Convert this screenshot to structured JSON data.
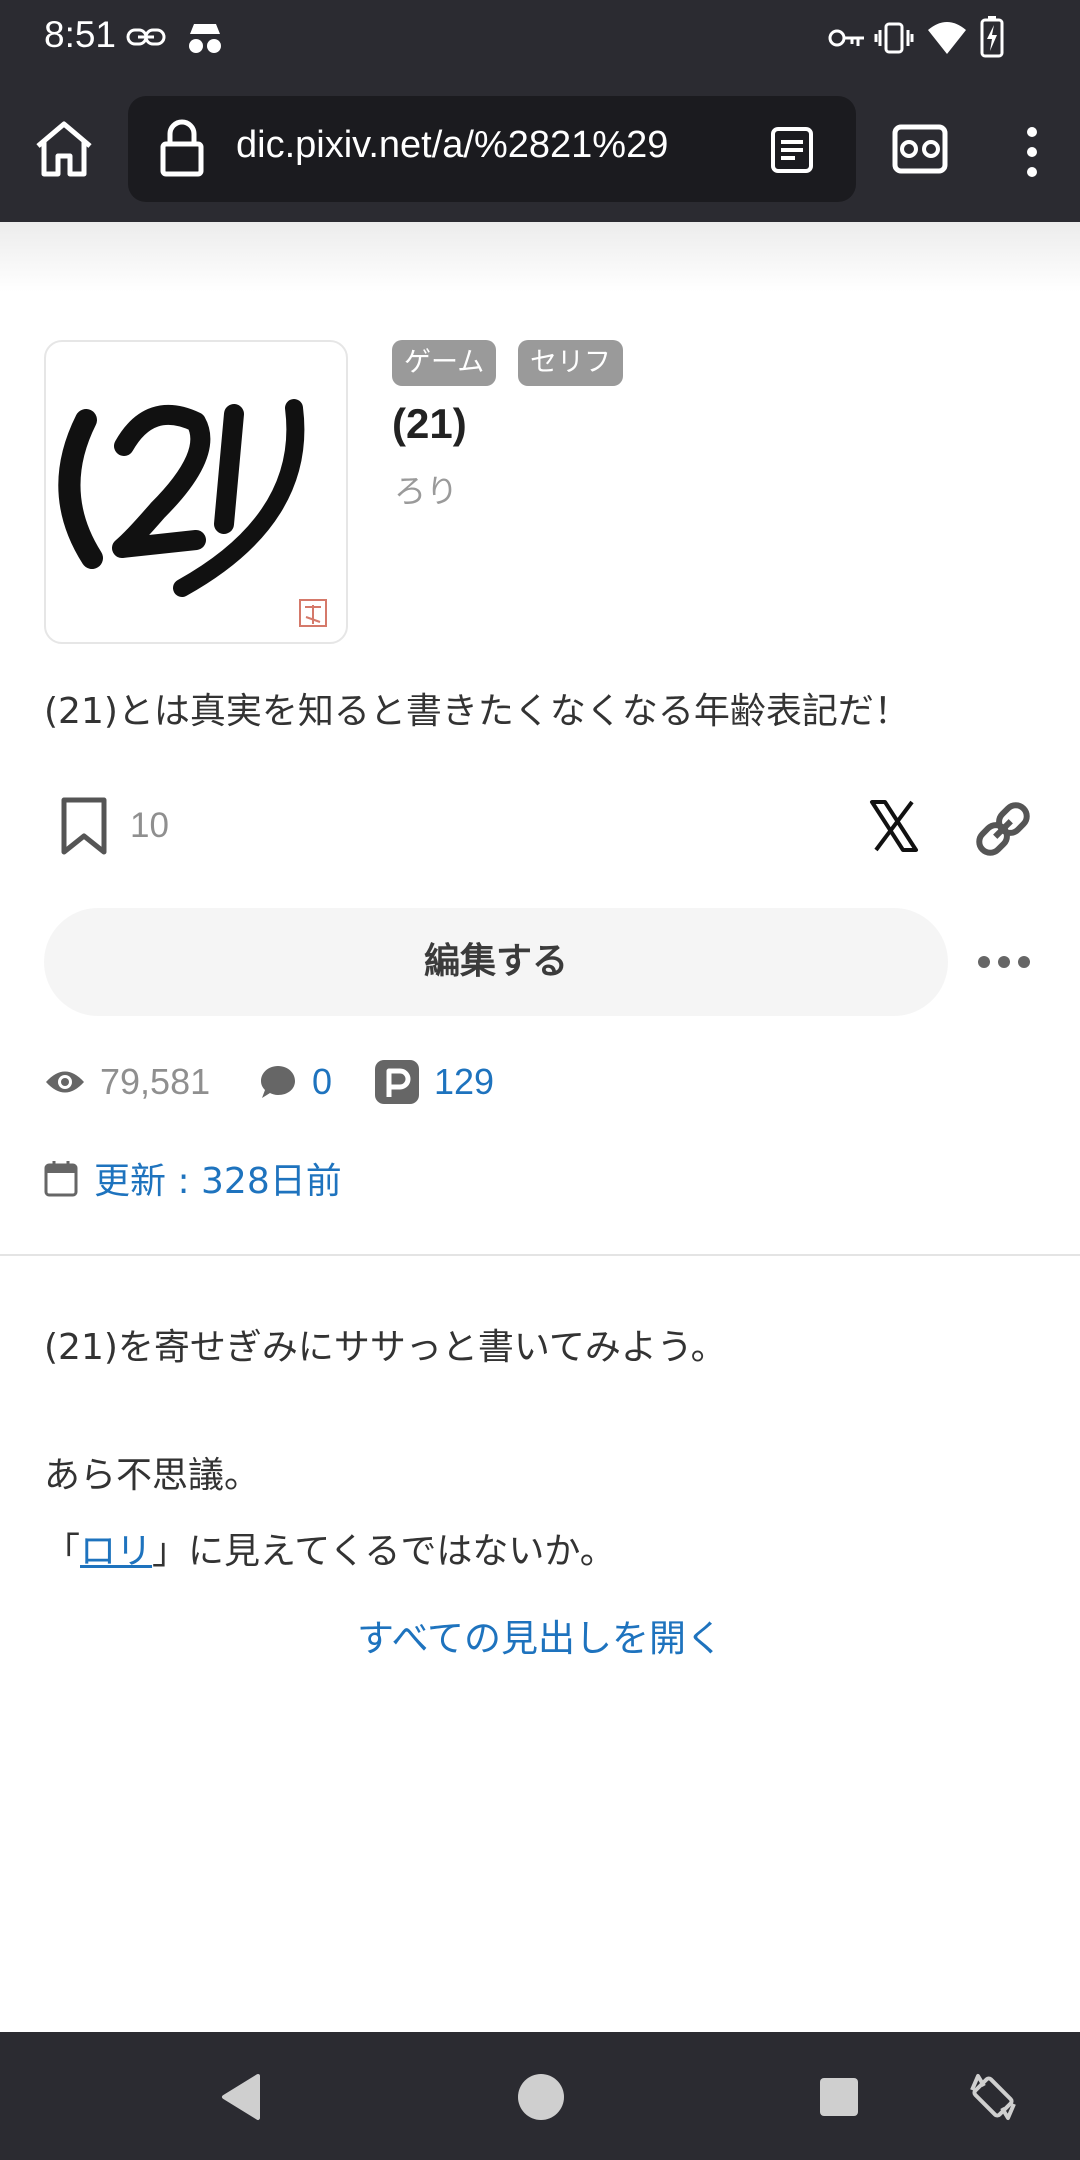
{
  "status_bar": {
    "time": "8:51"
  },
  "browser": {
    "url": "dic.pixiv.net/a/%2821%29"
  },
  "article": {
    "tags": [
      "ゲーム",
      "セリフ"
    ],
    "title": "(21)",
    "reading": "ろり",
    "summary": "(21)とは真実を知ると書きたくなくなる年齢表記だ！",
    "bookmark_count": "10",
    "edit_label": "編集する",
    "stats": {
      "views": "79,581",
      "comments": "0",
      "pixiv_works": "129"
    },
    "updated": "更新 : 328日前"
  },
  "body": {
    "line1": "(21)を寄せぎみにササっと書いてみよう。",
    "line2": "あら不思議。",
    "line3_prefix": "「",
    "line3_link": "ロリ",
    "line3_suffix": "」に見えてくるではないか。",
    "open_all": "すべての見出しを開く"
  },
  "colors": {
    "chrome_bg": "#2b2b31",
    "link_blue": "#1e73be",
    "tag_gray": "#9a9a9a"
  }
}
